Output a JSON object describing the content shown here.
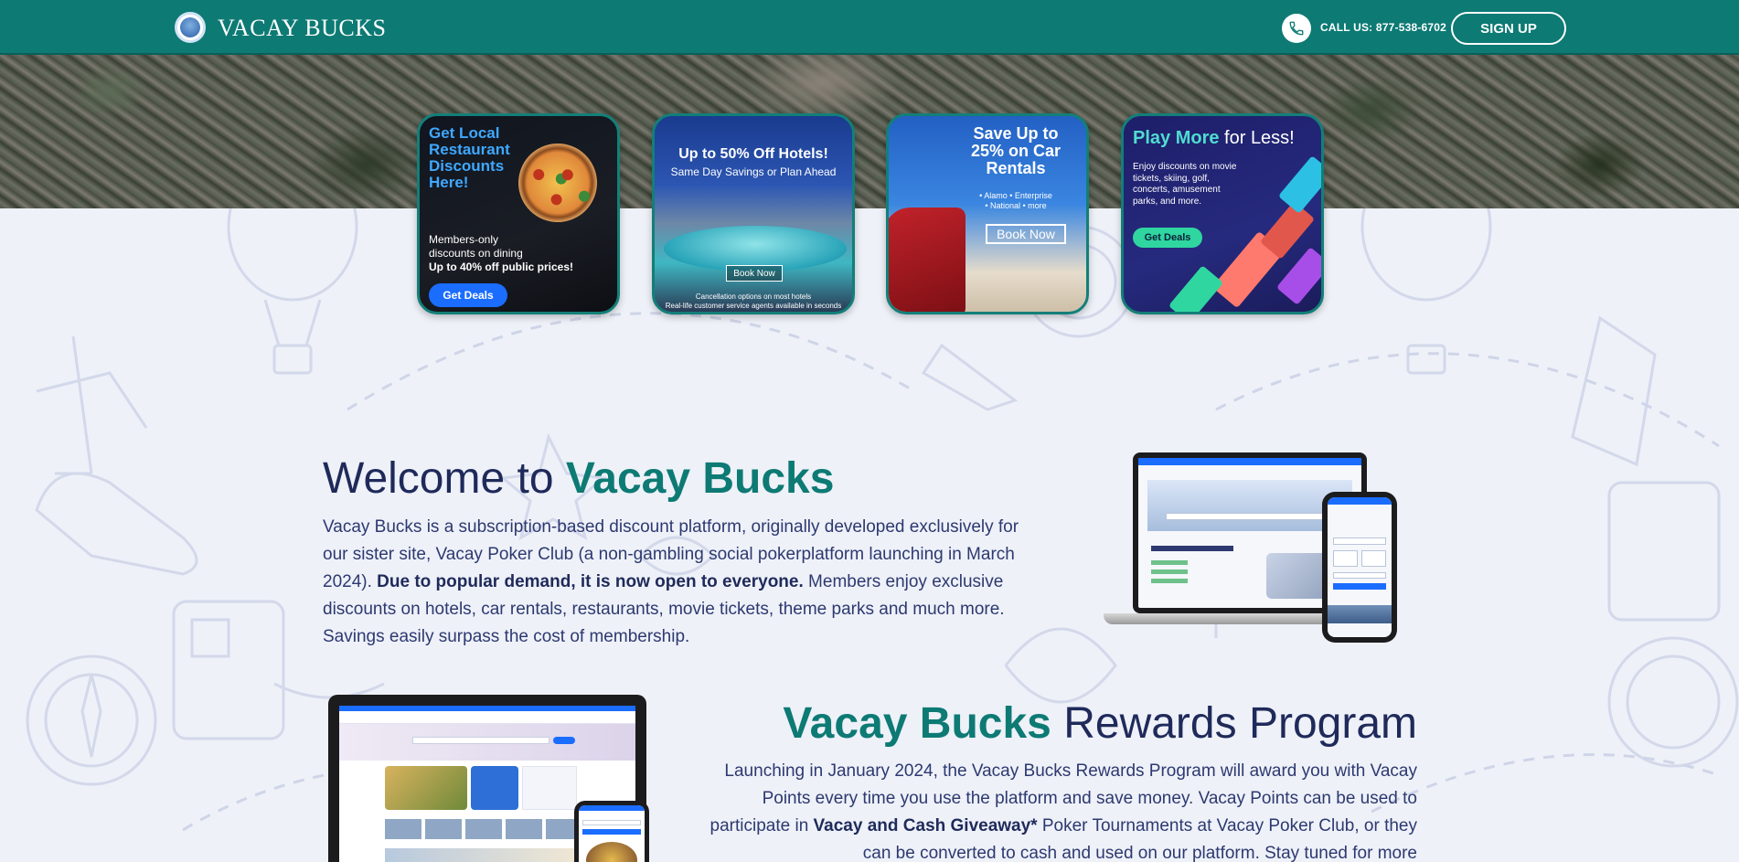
{
  "header": {
    "brand": "VACAY BUCKS",
    "call_label": "CALL US: 877-538-6702",
    "signup_label": "SIGN UP"
  },
  "promos": [
    {
      "title": "Get Local Restaurant Discounts Here!",
      "subtitle_line1": "Members-only",
      "subtitle_line2": "discounts on dining",
      "subtitle_line3": "Up to 40% off public prices!",
      "button": "Get Deals"
    },
    {
      "title": "Up to 50% Off Hotels!",
      "subtitle": "Same Day Savings or Plan Ahead",
      "button": "Book Now",
      "footer_line1": "Cancellation options on most hotels",
      "footer_line2": "Real-life customer service agents available in seconds"
    },
    {
      "title": "Save Up to 25% on Car Rentals",
      "subtitle_line1": "• Alamo • Enterprise",
      "subtitle_line2": "• National • more",
      "button": "Book Now"
    },
    {
      "title_main": "Play More",
      "title_rest": " for Less!",
      "subtitle": "Enjoy discounts on movie tickets, skiing, golf, concerts, amusement parks, and more.",
      "button": "Get Deals"
    }
  ],
  "welcome": {
    "title_plain": "Welcome to ",
    "title_accent": "Vacay Bucks",
    "text_part1": "Vacay Bucks is a subscription-based discount platform, originally developed exclusively for our sister site, Vacay Poker Club (a non-gambling social pokerplatform launching in March 2024). ",
    "text_bold": "Due to popular demand, it is now open to everyone.",
    "text_part2": " Members enjoy exclusive discounts on hotels, car rentals, restaurants, movie tickets, theme parks and much more. Savings easily surpass the cost of membership."
  },
  "rewards": {
    "title_accent": "Vacay Bucks",
    "title_plain": " Rewards Program",
    "text_part1": "Launching in January 2024, the Vacay Bucks Rewards Program will award you with Vacay Points every time you use the platform and save money. Vacay Points can be used to participate in ",
    "text_bold": "Vacay and Cash Giveaway*",
    "text_part2": " Poker Tournaments at Vacay Poker Club, or they can be converted to cash and used on our platform. Stay tuned for more"
  },
  "colors": {
    "header_bg": "#0d7a74",
    "accent_teal": "#0d7a74",
    "navy_text": "#1f2a5a",
    "page_bg": "#eef1f8"
  }
}
